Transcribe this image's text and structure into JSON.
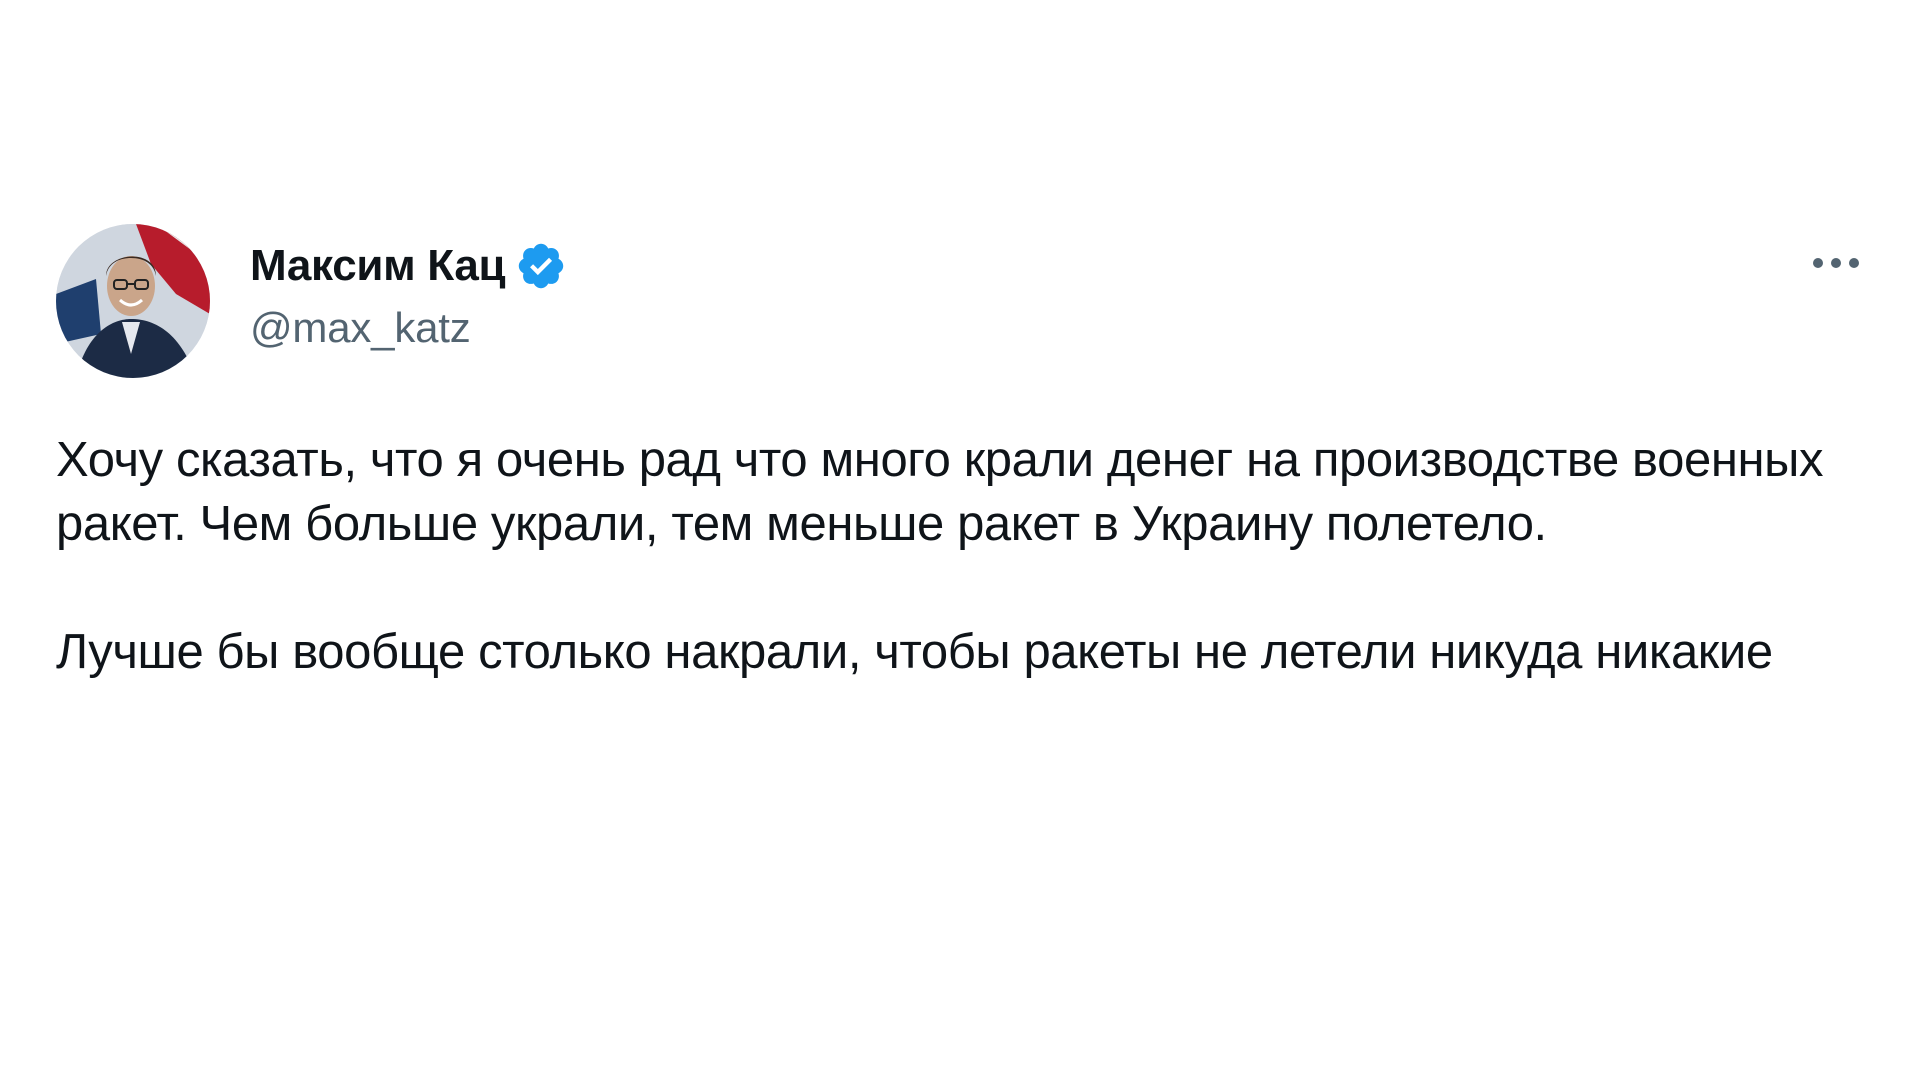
{
  "tweet": {
    "author": {
      "display_name": "Максим Кац",
      "handle": "@max_katz",
      "verified_color": "#1d9bf0"
    },
    "paragraphs": [
      "Хочу сказать, что я очень рад что много крали денег на производстве военных ракет. Чем больше украли, тем меньше ракет в Украину полетело.",
      "Лучше бы вообще столько накрали, чтобы ракеты не летели никуда никакие"
    ],
    "icons": {
      "verified": "verified-badge-icon",
      "more": "more-options-icon"
    }
  }
}
